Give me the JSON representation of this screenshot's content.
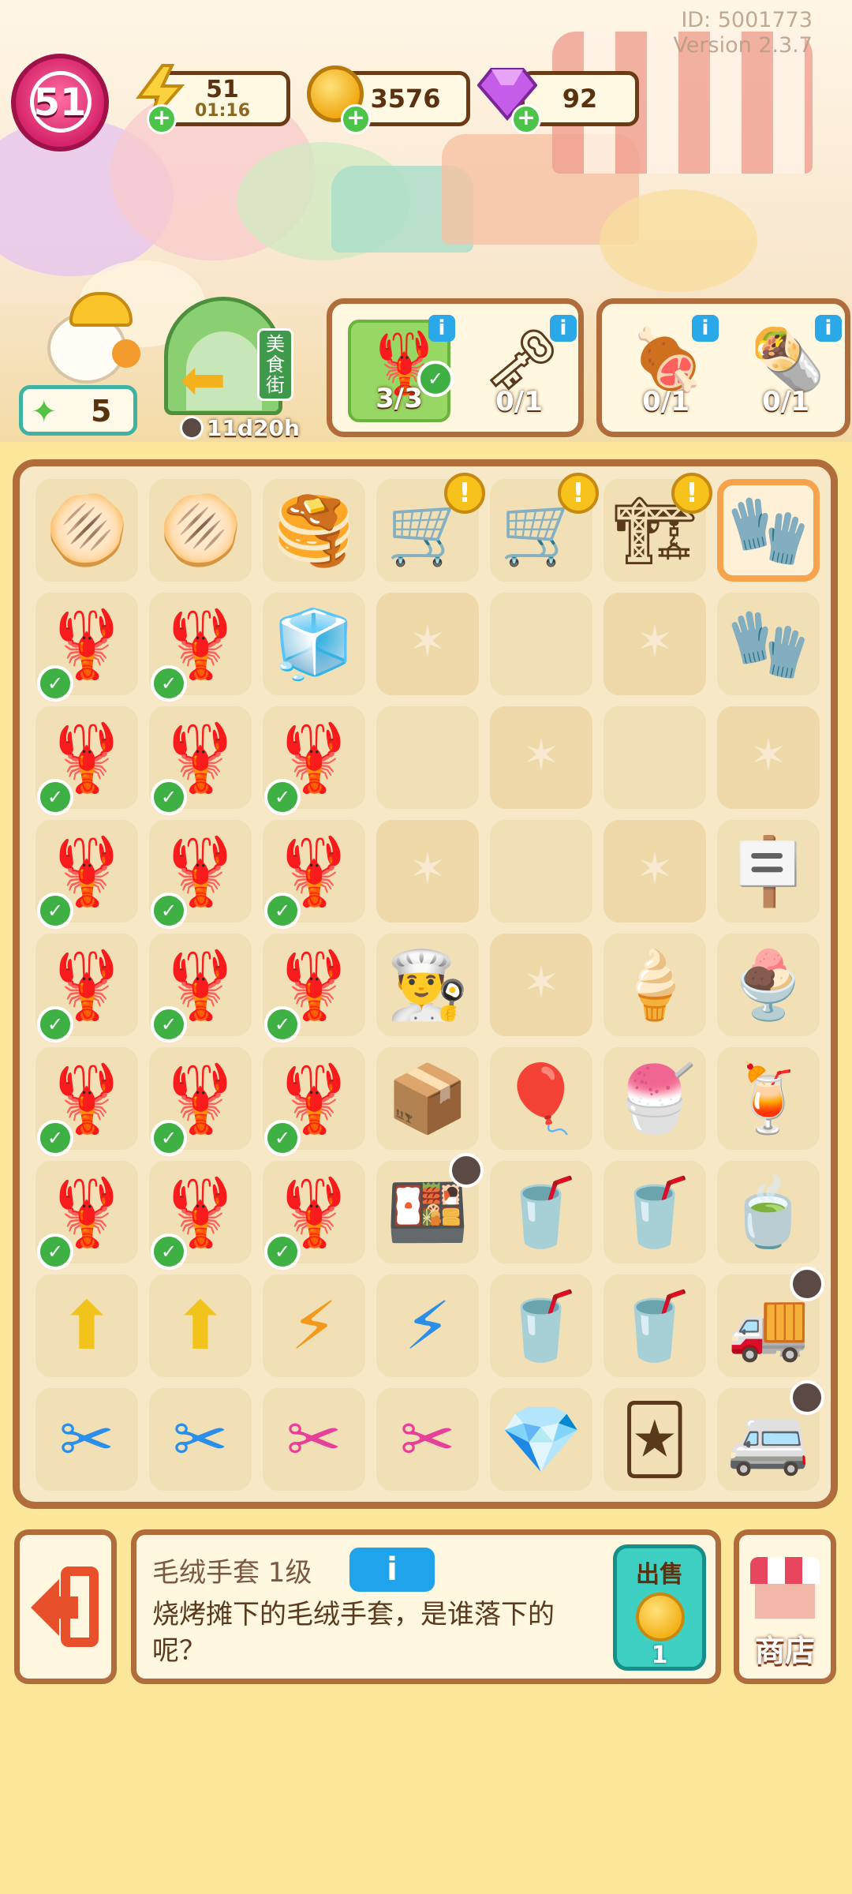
{
  "header": {
    "id_text": "ID: 5001773",
    "version_text": "Version 2.3.7",
    "level": "51",
    "energy": {
      "value": "51",
      "timer": "01:16"
    },
    "coins": "3576",
    "gems": "92"
  },
  "quest_area": {
    "star_count": "5",
    "event_timer": "11d20h",
    "event_sign": "美食街",
    "orders_group1": [
      {
        "count": "3/3",
        "complete": true
      },
      {
        "count": "0/1",
        "complete": false
      }
    ],
    "orders_group2": [
      {
        "count": "0/1",
        "complete": false
      },
      {
        "count": "0/1",
        "complete": false
      }
    ]
  },
  "board": {
    "rows": [
      [
        "pancake",
        "pancake",
        "pancake-stack",
        "bbq-cart",
        "bbq-cart",
        "build-site",
        "mitten"
      ],
      [
        "crayfish",
        "crayfish",
        "fridge",
        "web",
        "empty",
        "web",
        "mitten-duck"
      ],
      [
        "crayfish",
        "crayfish",
        "crayfish",
        "empty",
        "web",
        "empty",
        "web"
      ],
      [
        "crayfish",
        "crayfish",
        "crayfish",
        "web",
        "empty",
        "web",
        "open-sign"
      ],
      [
        "crayfish",
        "crayfish",
        "crayfish",
        "chef-hat",
        "web",
        "ice-cream",
        "sundae"
      ],
      [
        "crayfish",
        "crayfish",
        "crayfish",
        "boxes",
        "balloons",
        "ice-cream-cup",
        "parfait"
      ],
      [
        "crayfish",
        "crayfish",
        "crayfish",
        "lunchbox",
        "drink",
        "drink",
        "teacups"
      ],
      [
        "upgrade-card",
        "upgrade-card",
        "energy-orange",
        "energy-blue",
        "drink",
        "drink",
        "truck"
      ],
      [
        "scissors-blue",
        "scissors-blue",
        "scissors-pink",
        "scissors-pink",
        "gem-pink",
        "card",
        "van"
      ]
    ]
  },
  "bottom": {
    "item_name": "毛绒手套 1级",
    "info_label": "i",
    "item_desc": "烧烤摊下的毛绒手套，是谁落下的呢？",
    "sell_label": "出售",
    "sell_value": "1",
    "shop_label": "商店"
  },
  "icons": {
    "pancake": "🫓",
    "pancake-stack": "🥞",
    "bbq-cart": "🛒",
    "build-site": "🏗",
    "mitten": "🧤",
    "crayfish": "🦞",
    "fridge": "🧊",
    "mitten-duck": "🧤",
    "open-sign": "🪧",
    "chef-hat": "👨‍🍳",
    "ice-cream": "🍦",
    "sundae": "🍨",
    "boxes": "📦",
    "balloons": "🎈",
    "ice-cream-cup": "🍧",
    "parfait": "🍹",
    "lunchbox": "🍱",
    "drink": "🥤",
    "teacups": "🍵",
    "upgrade-card": "⬆",
    "energy-orange": "⚡",
    "energy-blue": "⚡",
    "truck": "🚚",
    "scissors-blue": "✂",
    "scissors-pink": "✂",
    "gem-pink": "💎",
    "card": "🃏",
    "van": "🚐"
  }
}
